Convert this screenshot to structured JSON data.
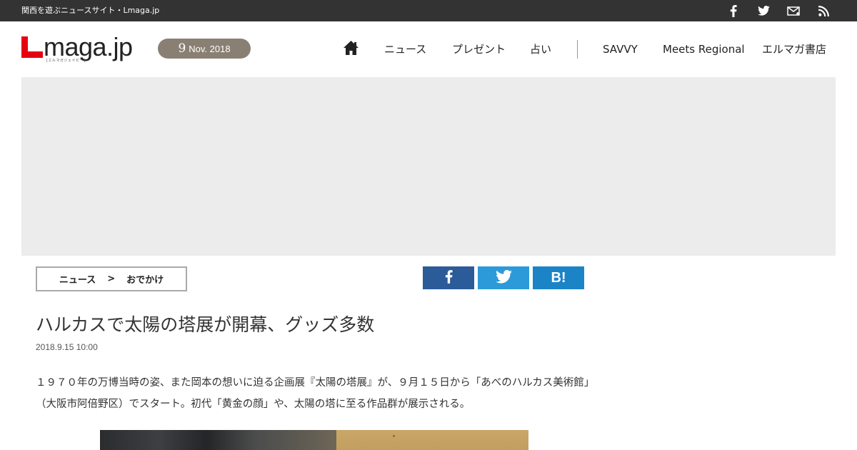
{
  "topbar": {
    "tagline": "関西を遊ぶニュースサイト・Lmaga.jp",
    "social_icons": [
      "facebook-icon",
      "twitter-icon",
      "mail-icon",
      "rss-icon"
    ]
  },
  "header": {
    "logo_text": "maga.jp",
    "logo_sub": "[エルマガジェイピー]",
    "date": {
      "day": "9",
      "month_year": "Nov. 2018"
    },
    "nav": {
      "home_icon": "home-icon",
      "items": [
        "ニュース",
        "プレゼント",
        "占い",
        "SAVVY",
        "Meets Regional",
        "エルマガ書店"
      ]
    }
  },
  "breadcrumb": {
    "items": [
      "ニュース",
      ">",
      "おでかけ"
    ]
  },
  "share": {
    "facebook_icon": "facebook-icon",
    "twitter_icon": "twitter-icon",
    "hatena_label": "B!"
  },
  "article": {
    "title": "ハルカスで太陽の塔展が開幕、グッズ多数",
    "date": "2018.9.15 10:00",
    "lead": "１９７０年の万博当時の姿、また岡本の想いに迫る企画展『太陽の塔展』が、９月１５日から「あべのハルカス美術館」（大阪市阿倍野区）でスタート。初代「黄金の顔」や、太陽の塔に至る作品群が展示される。"
  },
  "colors": {
    "topbar": "#333333",
    "logo_red": "#e60012",
    "date_pill": "#8a7f73",
    "ad_bg": "#ececec",
    "facebook": "#2b5b98",
    "twitter": "#2c9ad8",
    "hatena": "#1b84c7"
  }
}
